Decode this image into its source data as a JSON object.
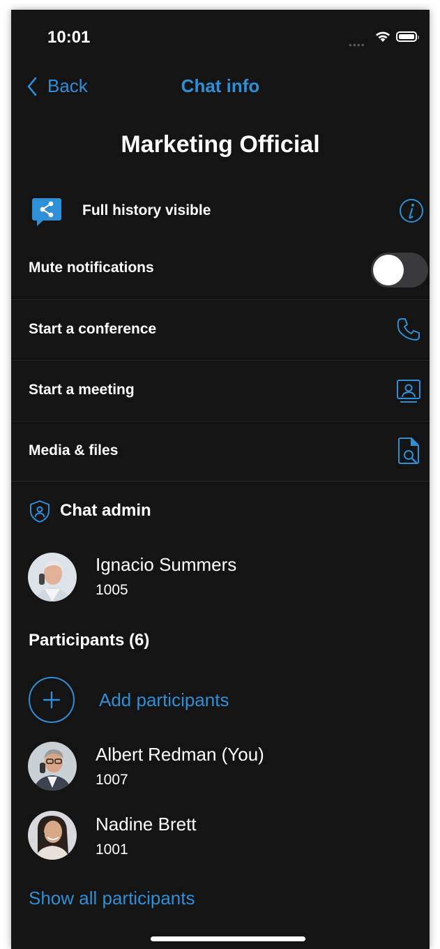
{
  "status_bar": {
    "time": "10:01"
  },
  "nav": {
    "back_label": "Back",
    "title": "Chat info"
  },
  "chat": {
    "name": "Marketing Official"
  },
  "history": {
    "label": "Full history visible",
    "icon": "share-chat-icon"
  },
  "options": {
    "mute": {
      "label": "Mute notifications",
      "enabled": false
    },
    "conference": {
      "label": "Start a conference",
      "icon": "phone-icon"
    },
    "meeting": {
      "label": "Start a meeting",
      "icon": "presentation-icon"
    },
    "media": {
      "label": "Media & files",
      "icon": "file-search-icon"
    }
  },
  "admin": {
    "title": "Chat admin",
    "person": {
      "name": "Ignacio Summers",
      "ext": "1005"
    }
  },
  "participants": {
    "title": "Participants (6)",
    "add_label": "Add participants",
    "list": [
      {
        "name": "Albert Redman (You)",
        "ext": "1007"
      },
      {
        "name": "Nadine Brett",
        "ext": "1001"
      }
    ],
    "show_all": "Show all participants"
  },
  "colors": {
    "accent": "#2d8fd8",
    "background": "#141414",
    "divider": "#262626"
  }
}
